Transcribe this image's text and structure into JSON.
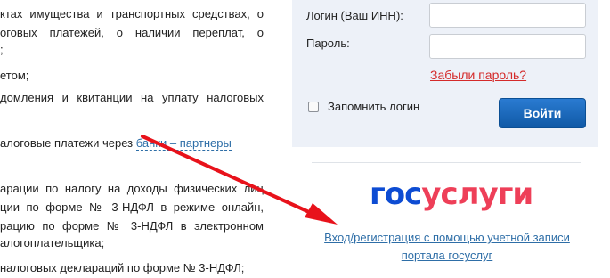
{
  "article": {
    "lines": [
      "ктах имущества и транспортных средствах, о",
      "оговых платежей, о наличии переплат, о",
      ";",
      "етом;",
      "домления и квитанции на уплату налоговых",
      "",
      "алоговые платежи через ",
      "",
      "арации по налогу на доходы физических лиц",
      "ции по форме № 3-НДФЛ в режиме онлайн,",
      "рацию по форме № 3-НДФЛ в электронном",
      "алогоплательщика;",
      "",
      "налоговых деклараций по форме № 3-НДФЛ;"
    ],
    "bank_link": "банки – партнеры"
  },
  "login": {
    "login_label": "Логин (Ваш ИНН):",
    "password_label": "Пароль:",
    "login_value": "",
    "password_value": "",
    "forgot_password": "Забыли пароль?",
    "remember_label": "Запомнить логин",
    "remember_checked": false,
    "submit_label": "Войти"
  },
  "gosuslugi": {
    "logo_part1": "гос",
    "logo_part2": "услуги",
    "link_text": "Вход/регистрация с помощью учетной записи портала госуслуг"
  },
  "colors": {
    "panel_bg": "#edf1f8",
    "button": "#1a66b8",
    "forgot_link": "#d42a2a",
    "logo_gos": "#0d4cd3",
    "logo_uslugi": "#ee3f58",
    "link": "#2e6ea7",
    "arrow": "#e8121b"
  },
  "icons": {
    "arrow": "red-arrow-icon"
  }
}
